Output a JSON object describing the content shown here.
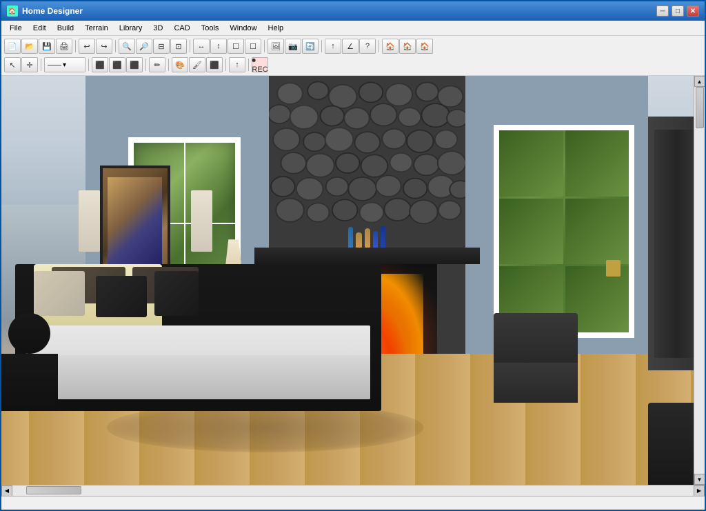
{
  "window": {
    "title": "Home Designer",
    "controls": {
      "minimize": "─",
      "maximize": "□",
      "close": "✕"
    }
  },
  "menu": {
    "items": [
      "File",
      "Edit",
      "Build",
      "Terrain",
      "Library",
      "3D",
      "CAD",
      "Tools",
      "Window",
      "Help"
    ]
  },
  "toolbar1": {
    "buttons": [
      "📄",
      "📂",
      "💾",
      "🖨",
      "⎌",
      "⎏",
      "🔍",
      "🔎",
      "🔍",
      "⊟",
      "⊡",
      "⊞",
      "↔",
      "↕",
      "☐",
      "☐",
      "🖼",
      "↩",
      "↪",
      "✋",
      "✏",
      "⬛",
      "▶",
      "?",
      "🏠",
      "🏠",
      "🏠"
    ]
  },
  "toolbar2": {
    "buttons": [
      "↖",
      "↔",
      "─",
      "⬛",
      "⬛",
      "⬛",
      "⬛",
      "✏",
      "─",
      "⬛",
      "⬛",
      "⬛",
      "↑",
      "⬛",
      "◉"
    ]
  },
  "scene": {
    "description": "3D bedroom interior with fireplace",
    "room_type": "Bedroom"
  },
  "statusbar": {
    "text": ""
  }
}
